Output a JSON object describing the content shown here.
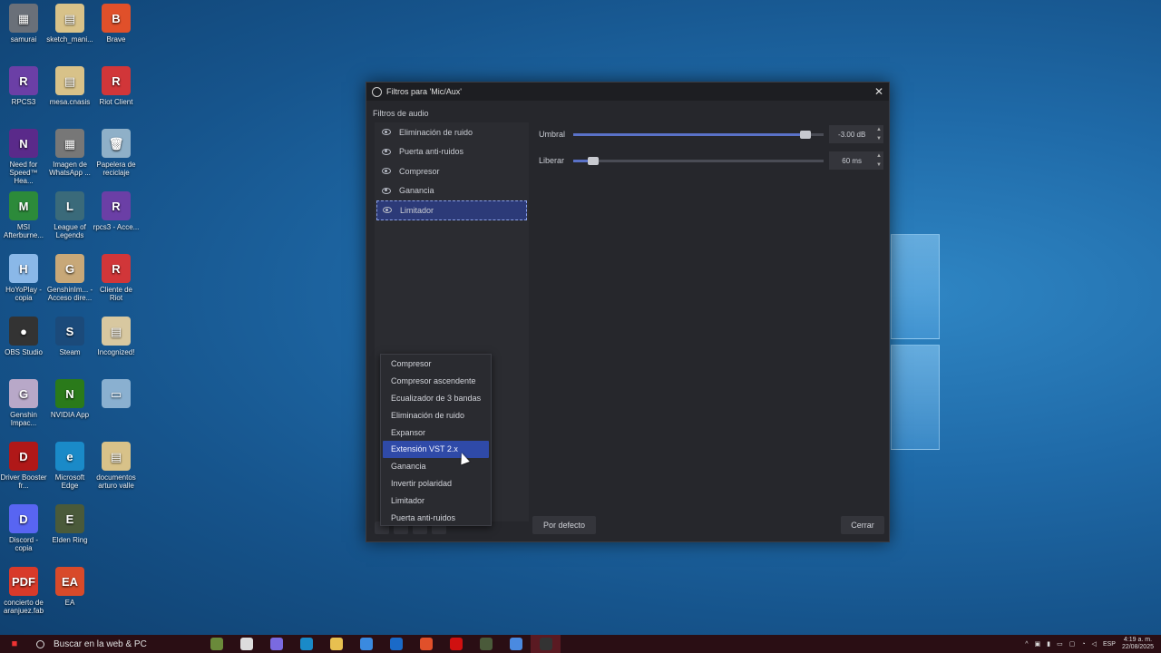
{
  "desktop": {
    "icons": [
      {
        "label": "samurai",
        "color": "#6a7079",
        "glyph": "▦"
      },
      {
        "label": "sketch_mani...",
        "color": "#d8c289",
        "glyph": "▤"
      },
      {
        "label": "Brave",
        "color": "#e0502a",
        "glyph": "B"
      },
      {
        "label": "RPCS3",
        "color": "#6b3fa6",
        "glyph": "R"
      },
      {
        "label": "mesa.cnasis",
        "color": "#d8c289",
        "glyph": "▤"
      },
      {
        "label": "Riot Client",
        "color": "#d13639",
        "glyph": "R"
      },
      {
        "label": "Need for Speed™ Hea...",
        "color": "#5a2a8a",
        "glyph": "N"
      },
      {
        "label": "Imagen de WhatsApp ...",
        "color": "#777",
        "glyph": "▦"
      },
      {
        "label": "Papelera de reciclaje",
        "color": "#8fb0c8",
        "glyph": "🗑"
      },
      {
        "label": "MSI Afterburne...",
        "color": "#2c8a3a",
        "glyph": "M"
      },
      {
        "label": "League of Legends",
        "color": "#3a6a7a",
        "glyph": "L"
      },
      {
        "label": "rpcs3 - Acce...",
        "color": "#6b3fa6",
        "glyph": "R"
      },
      {
        "label": "HoYoPlay - copia",
        "color": "#8ab8e8",
        "glyph": "H"
      },
      {
        "label": "GenshinIm... - Acceso dire...",
        "color": "#c8a878",
        "glyph": "G"
      },
      {
        "label": "Cliente de Riot",
        "color": "#d13639",
        "glyph": "R"
      },
      {
        "label": "OBS Studio",
        "color": "#333",
        "glyph": "●"
      },
      {
        "label": "Steam",
        "color": "#1b4a7a",
        "glyph": "S"
      },
      {
        "label": "Incognized!",
        "color": "#d8c8a0",
        "glyph": "▤"
      },
      {
        "label": "Genshin Impac...",
        "color": "#b8a8c8",
        "glyph": "G"
      },
      {
        "label": "NVIDIA App",
        "color": "#2a7a1a",
        "glyph": "N"
      },
      {
        "label": "",
        "color": "#8ab0d0",
        "glyph": "▭"
      },
      {
        "label": "Driver Booster fr...",
        "color": "#b01818",
        "glyph": "D"
      },
      {
        "label": "Microsoft Edge",
        "color": "#1a8ac8",
        "glyph": "e"
      },
      {
        "label": "documentos arturo valle",
        "color": "#d8c289",
        "glyph": "▤"
      },
      {
        "label": "Discord - copia",
        "color": "#5865f2",
        "glyph": "D"
      },
      {
        "label": "Elden Ring",
        "color": "#4a5a3a",
        "glyph": "E"
      },
      {
        "label": "",
        "color": "",
        "glyph": ""
      },
      {
        "label": "concierto de aranjuez.fab",
        "color": "#d83a2a",
        "glyph": "PDF"
      },
      {
        "label": "EA",
        "color": "#d84a2a",
        "glyph": "EA"
      },
      {
        "label": "",
        "color": "",
        "glyph": ""
      }
    ]
  },
  "dialog": {
    "title": "Filtros para 'Mic/Aux'",
    "section_label": "Filtros de audio",
    "filters": [
      {
        "label": "Eliminación de ruido"
      },
      {
        "label": "Puerta anti-ruidos"
      },
      {
        "label": "Compresor"
      },
      {
        "label": "Ganancia"
      },
      {
        "label": "Limitador"
      }
    ],
    "selected_filter": "Limitador",
    "properties": {
      "threshold": {
        "label": "Umbral",
        "value": "-3.00 dB",
        "level": 0.92
      },
      "release": {
        "label": "Liberar",
        "value": "60 ms",
        "level": 0.08
      }
    },
    "defaults_button": "Por defecto",
    "close_button": "Cerrar"
  },
  "add_filter_menu": {
    "items": [
      "Compresor",
      "Compresor ascendente",
      "Ecualizador de 3 bandas",
      "Eliminación de ruido",
      "Expansor",
      "Extensión VST 2.x",
      "Ganancia",
      "Invertir polaridad",
      "Limitador",
      "Puerta anti-ruidos"
    ],
    "highlighted": "Extensión VST 2.x"
  },
  "taskbar": {
    "search_placeholder": "Buscar en la web & PC",
    "language": "ESP",
    "time": "4:19 a. m.",
    "date": "22/08/2025",
    "apps": [
      {
        "name": "widgets-icon",
        "color": "#6a8a3a"
      },
      {
        "name": "task-view-icon",
        "color": "#dddddd"
      },
      {
        "name": "copilot-icon",
        "color": "#7a6ae0"
      },
      {
        "name": "edge-icon",
        "color": "#1a8ac8"
      },
      {
        "name": "file-explorer-icon",
        "color": "#e8c050"
      },
      {
        "name": "store-icon",
        "color": "#3a8ae0"
      },
      {
        "name": "outlook-icon",
        "color": "#1a6ac8"
      },
      {
        "name": "brave-icon",
        "color": "#e0502a"
      },
      {
        "name": "netflix-icon",
        "color": "#d01010"
      },
      {
        "name": "game-icon",
        "color": "#4a5a3a"
      },
      {
        "name": "chrome-icon",
        "color": "#4a8ae0"
      },
      {
        "name": "obs-icon",
        "color": "#333333"
      }
    ]
  }
}
